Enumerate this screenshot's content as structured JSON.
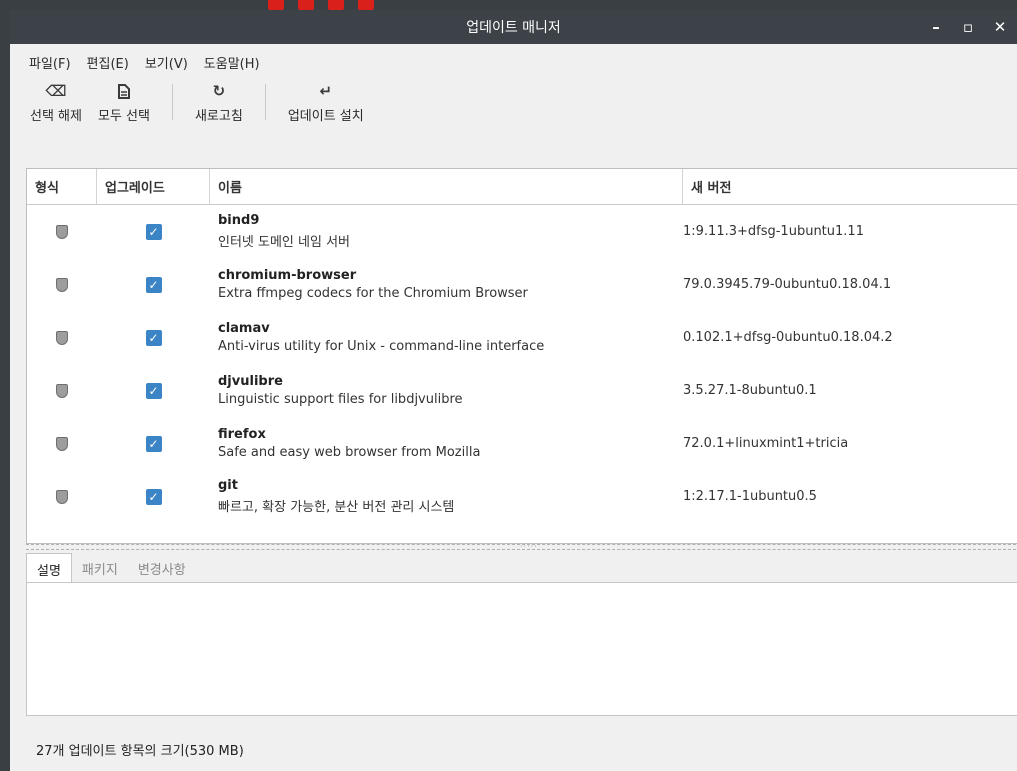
{
  "window": {
    "title": "업데이트 매니저",
    "controls": [
      "minimize-icon",
      "maximize-icon",
      "close-icon"
    ]
  },
  "menu": [
    "파일(F)",
    "편집(E)",
    "보기(V)",
    "도움말(H)"
  ],
  "toolbar": {
    "clear_selection": "선택 해제",
    "select_all": "모두 선택",
    "refresh": "새로고침",
    "install_updates": "업데이트 설치"
  },
  "columns": {
    "type": "형식",
    "upgrade": "업그레이드",
    "name": "이름",
    "new_version": "새 버전"
  },
  "updates": [
    {
      "name": "bind9",
      "description": "인터넷 도메인 네임 서버",
      "version": "1:9.11.3+dfsg-1ubuntu1.11",
      "checked": true
    },
    {
      "name": "chromium-browser",
      "description": "Extra ffmpeg codecs for the Chromium Browser",
      "version": "79.0.3945.79-0ubuntu0.18.04.1",
      "checked": true
    },
    {
      "name": "clamav",
      "description": "Anti-virus utility for Unix - command-line interface",
      "version": "0.102.1+dfsg-0ubuntu0.18.04.2",
      "checked": true
    },
    {
      "name": "djvulibre",
      "description": "Linguistic support files for libdjvulibre",
      "version": "3.5.27.1-8ubuntu0.1",
      "checked": true
    },
    {
      "name": "firefox",
      "description": "Safe and easy web browser from Mozilla",
      "version": "72.0.1+linuxmint1+tricia",
      "checked": true
    },
    {
      "name": "git",
      "description": "빠르고, 확장 가능한, 분산 버전 관리 시스템",
      "version": "1:2.17.1-1ubuntu0.5",
      "checked": true
    }
  ],
  "tabs": [
    "설명",
    "패키지",
    "변경사항"
  ],
  "status": "27개 업데이트 항목의 크기(530 MB)",
  "colors": {
    "titlebar": "#3c4247",
    "checkbox": "#3b85c6",
    "window_bg": "#f0f0f0"
  },
  "icons": {
    "clear_selection": "backspace-icon",
    "select_all": "document-icon",
    "refresh": "refresh-icon",
    "install_updates": "return-arrow-icon",
    "type": "shield-icon"
  }
}
